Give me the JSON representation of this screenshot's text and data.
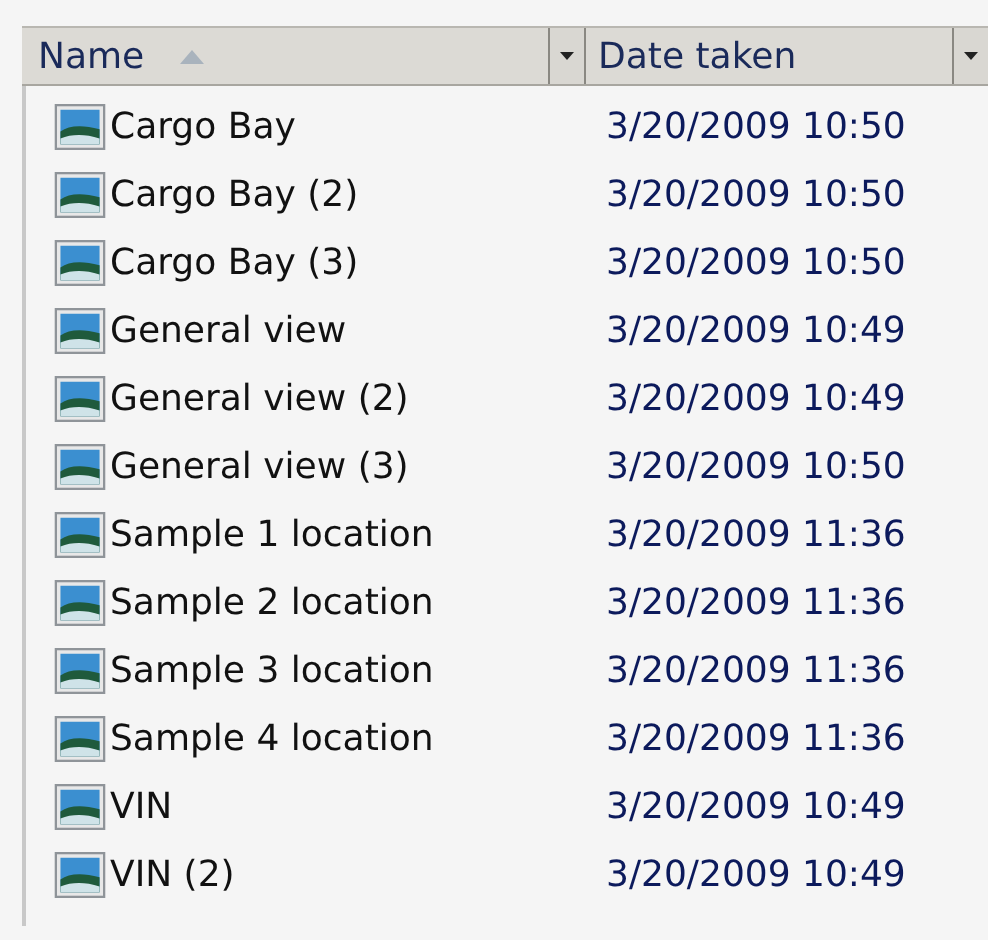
{
  "table": {
    "columns": [
      {
        "label": "Name",
        "sorted": true
      },
      {
        "label": "Date taken",
        "sorted": false
      }
    ],
    "rows": [
      {
        "name": "Cargo Bay",
        "date": "3/20/2009 10:50"
      },
      {
        "name": "Cargo Bay (2)",
        "date": "3/20/2009 10:50"
      },
      {
        "name": "Cargo Bay (3)",
        "date": "3/20/2009 10:50"
      },
      {
        "name": "General view",
        "date": "3/20/2009 10:49"
      },
      {
        "name": "General view (2)",
        "date": "3/20/2009 10:49"
      },
      {
        "name": "General view (3)",
        "date": "3/20/2009 10:50"
      },
      {
        "name": "Sample 1 location",
        "date": "3/20/2009 11:36"
      },
      {
        "name": "Sample 2 location",
        "date": "3/20/2009 11:36"
      },
      {
        "name": "Sample 3 location",
        "date": "3/20/2009 11:36"
      },
      {
        "name": "Sample 4 location",
        "date": "3/20/2009 11:36"
      },
      {
        "name": "VIN",
        "date": "3/20/2009 10:49"
      },
      {
        "name": "VIN (2)",
        "date": "3/20/2009 10:49"
      }
    ]
  }
}
